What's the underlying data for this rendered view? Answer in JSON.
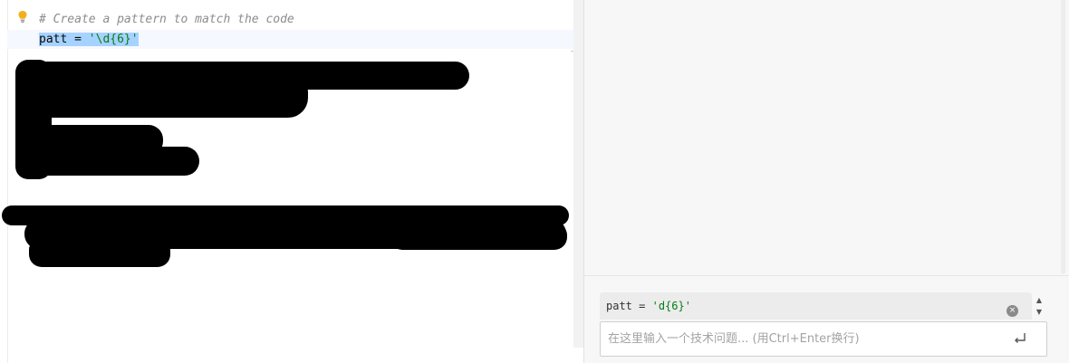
{
  "editor": {
    "lines": [
      {
        "text": "# Create a pattern to match the code"
      },
      {
        "var": "patt",
        "op": " = ",
        "str": "'\\d{6}'"
      }
    ],
    "gutter_icon": "lightbulb-icon"
  },
  "assistant": {
    "preview": {
      "var": "patt",
      "op": " = ",
      "str": "'d{6}'"
    },
    "clear_icon": "clear-icon",
    "clear_glyph": "×",
    "scroll_up_glyph": "▲",
    "scroll_down_glyph": "▼",
    "input_placeholder": "在这里输入一个技术问题... (用Ctrl+Enter换行)",
    "send_icon": "enter-return-icon"
  },
  "colors": {
    "selection": "#a6d2ff",
    "string": "#067d17",
    "comment": "#8c8c8c",
    "bulb": "#f2b01e"
  }
}
